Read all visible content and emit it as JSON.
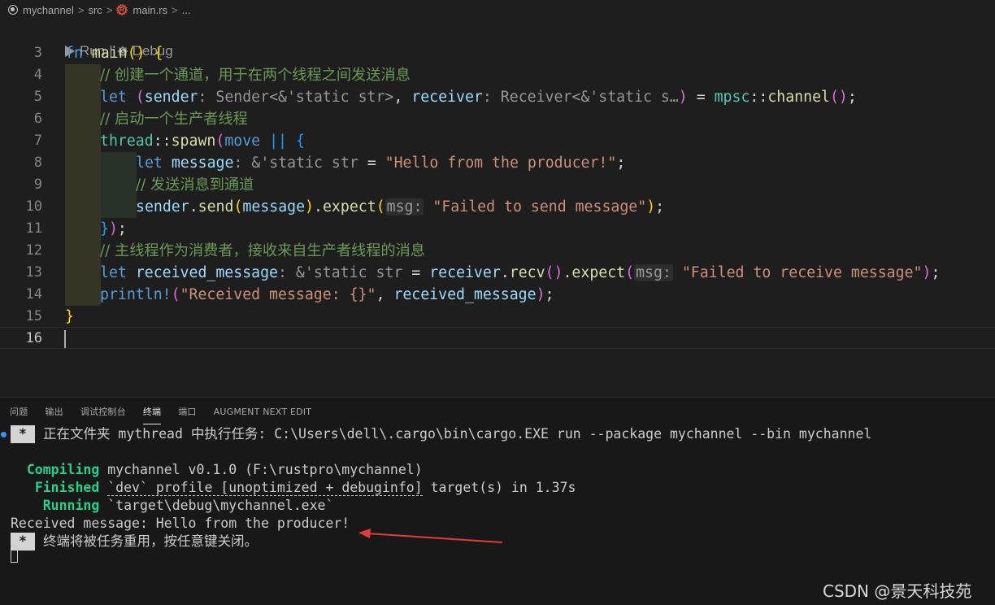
{
  "breadcrumb": {
    "items": [
      "mychannel",
      "src",
      "main.rs",
      "..."
    ],
    "separator": ">"
  },
  "editor": {
    "codelens": {
      "run": "Run",
      "pipe": "|",
      "debug": "Debug"
    },
    "line_numbers": [
      "3",
      "4",
      "5",
      "6",
      "7",
      "8",
      "9",
      "10",
      "11",
      "12",
      "13",
      "14",
      "15",
      "16"
    ],
    "lines": {
      "l3": {
        "fn": "fn",
        "name": "main",
        "parens": "()",
        "brace": "{"
      },
      "l4": {
        "comment": "// 创建一个通道，用于在两个线程之间发送消息"
      },
      "l5": {
        "let": "let",
        "open": "(",
        "sender": "sender",
        "sender_hint": ": Sender<&'static str>",
        "comma": ", ",
        "receiver": "receiver",
        "receiver_hint": ": Receiver<&'static s…",
        "close": ")",
        "eq": " = ",
        "mod": "mpsc",
        "path": "::",
        "fn": "channel",
        "call": "()",
        "semi": ";"
      },
      "l6": {
        "comment": "// 启动一个生产者线程"
      },
      "l7": {
        "mod": "thread",
        "path": "::",
        "fn": "spawn",
        "open": "(",
        "move": "move",
        "pipes": " || ",
        "brace": "{"
      },
      "l8": {
        "let": "let",
        "var": "message",
        "hint": ": &'static str",
        "eq": " = ",
        "str": "\"Hello from the producer!\"",
        "semi": ";"
      },
      "l9": {
        "comment": "// 发送消息到通道"
      },
      "l10": {
        "var": "sender",
        "dot": ".",
        "fn": "send",
        "open": "(",
        "arg": "message",
        "close": ")",
        "dot2": ".",
        "fn2": "expect",
        "open2": "(",
        "hint": "msg:",
        "str": " \"Failed to send message\"",
        "close2": ")",
        "semi": ";"
      },
      "l11": {
        "brace": "}",
        "paren": ")",
        "semi": ";"
      },
      "l12": {
        "comment": "// 主线程作为消费者，接收来自生产者线程的消息"
      },
      "l13": {
        "let": "let",
        "var": "received_message",
        "hint": ": &'static str",
        "eq": " = ",
        "recv": "receiver",
        "dot": ".",
        "fn": "recv",
        "call": "()",
        "dot2": ".",
        "fn2": "expect",
        "open": "(",
        "hint2": "msg:",
        "str": " \"Failed to receive message\"",
        "close": ")",
        "semi": ";"
      },
      "l14": {
        "macro": "println!",
        "open": "(",
        "str": "\"Received message: {}\"",
        "comma": ", ",
        "var": "received_message",
        "close": ")",
        "semi": ";"
      },
      "l15": {
        "brace": "}"
      }
    }
  },
  "panel": {
    "tabs": [
      "问题",
      "输出",
      "调试控制台",
      "终端",
      "端口",
      "AUGMENT NEXT EDIT"
    ],
    "active_tab": "终端"
  },
  "terminal": {
    "star": "*",
    "task_line": "正在文件夹 mythread 中执行任务: C:\\Users\\dell\\.cargo\\bin\\cargo.EXE run --package mychannel --bin mychannel",
    "compiling_label": "Compiling",
    "compiling_text": " mychannel v0.1.0 (F:\\rustpro\\mychannel)",
    "finished_label": "Finished",
    "finished_dev": "`dev` profile [unoptimized + debuginfo]",
    "finished_rest": " target(s) in 1.37s",
    "running_label": "Running",
    "running_text": " `target\\debug\\mychannel.exe`",
    "output_line": "Received message: Hello from the producer!",
    "reuse_line": "终端将被任务重用，按任意键关闭。"
  },
  "watermark": "CSDN @景天科技苑",
  "colors": {
    "background": "#1e1e1e",
    "panel_bg": "#181818",
    "keyword": "#569cd6",
    "function": "#dcdcaa",
    "string": "#ce9178",
    "comment": "#6a9955",
    "green_status": "#23d18b",
    "arrow": "#e03c3c"
  }
}
